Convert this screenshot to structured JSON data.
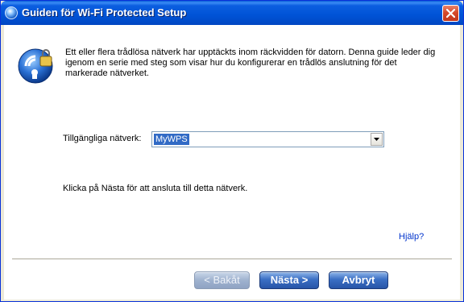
{
  "window": {
    "title": "Guiden för Wi-Fi Protected Setup",
    "close_label": "Stäng"
  },
  "intro_text": "Ett eller flera trådlösa nätverk har upptäckts inom räckvidden för datorn. Denna guide leder dig igenom en serie med steg som visar hur du konfigurerar en trådlös anslutning för det markerade nätverket.",
  "network": {
    "label": "Tillgängliga nätverk:",
    "selected": "MyWPS"
  },
  "hint_text": "Klicka på Nästa för att ansluta till detta nätverk.",
  "help_link": "Hjälp?",
  "buttons": {
    "back": "< Bakåt",
    "next": "Nästa >",
    "cancel": "Avbryt"
  },
  "icons": {
    "title": "wifi-setup-icon",
    "wizard": "wifi-lock-icon",
    "close": "close-icon",
    "dropdown": "chevron-down-icon"
  }
}
